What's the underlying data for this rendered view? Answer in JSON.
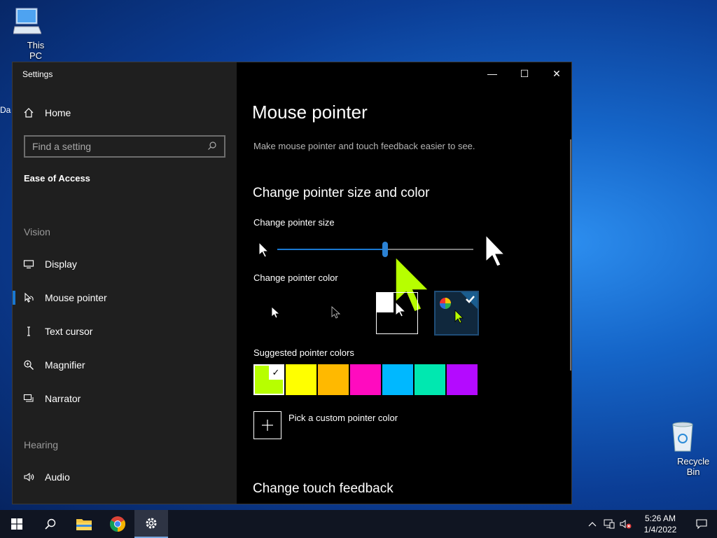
{
  "desktop": {
    "this_pc_label": "This PC",
    "recycle_bin_label": "Recycle Bin",
    "partial_label": "Da"
  },
  "window": {
    "title": "Settings",
    "controls": {
      "minimize": "—",
      "maximize": "☐",
      "close": "✕"
    }
  },
  "sidebar": {
    "home_label": "Home",
    "search_placeholder": "Find a setting",
    "section_title": "Ease of Access",
    "groups": [
      {
        "title": "Vision"
      },
      {
        "title": "Hearing"
      }
    ],
    "items": [
      {
        "label": "Display",
        "icon": "monitor-icon"
      },
      {
        "label": "Mouse pointer",
        "icon": "mouse-pointer-icon",
        "selected": true
      },
      {
        "label": "Text cursor",
        "icon": "text-cursor-icon"
      },
      {
        "label": "Magnifier",
        "icon": "magnifier-icon"
      },
      {
        "label": "Narrator",
        "icon": "narrator-icon"
      },
      {
        "label": "Audio",
        "icon": "speaker-icon"
      }
    ]
  },
  "main": {
    "title": "Mouse pointer",
    "description": "Make mouse pointer and touch feedback easier to see.",
    "section1_title": "Change pointer size and color",
    "size_label": "Change pointer size",
    "size_value_fraction": 0.55,
    "color_label": "Change pointer color",
    "color_options": [
      "white",
      "black",
      "inverted",
      "custom"
    ],
    "selected_color_option": "custom",
    "suggested_label": "Suggested pointer colors",
    "suggested_colors": [
      "#b7ff00",
      "#ffff00",
      "#ffb900",
      "#ff0bbf",
      "#00b8ff",
      "#00e8b0",
      "#b40aff"
    ],
    "selected_suggested_color": "#b7ff00",
    "custom_color_label": "Pick a custom pointer color",
    "section2_title": "Change touch feedback"
  },
  "taskbar": {
    "time": "5:26 AM",
    "date": "1/4/2022",
    "pinned": [
      "start-icon",
      "search-icon",
      "file-explorer-icon",
      "chrome-icon",
      "settings-icon"
    ]
  }
}
